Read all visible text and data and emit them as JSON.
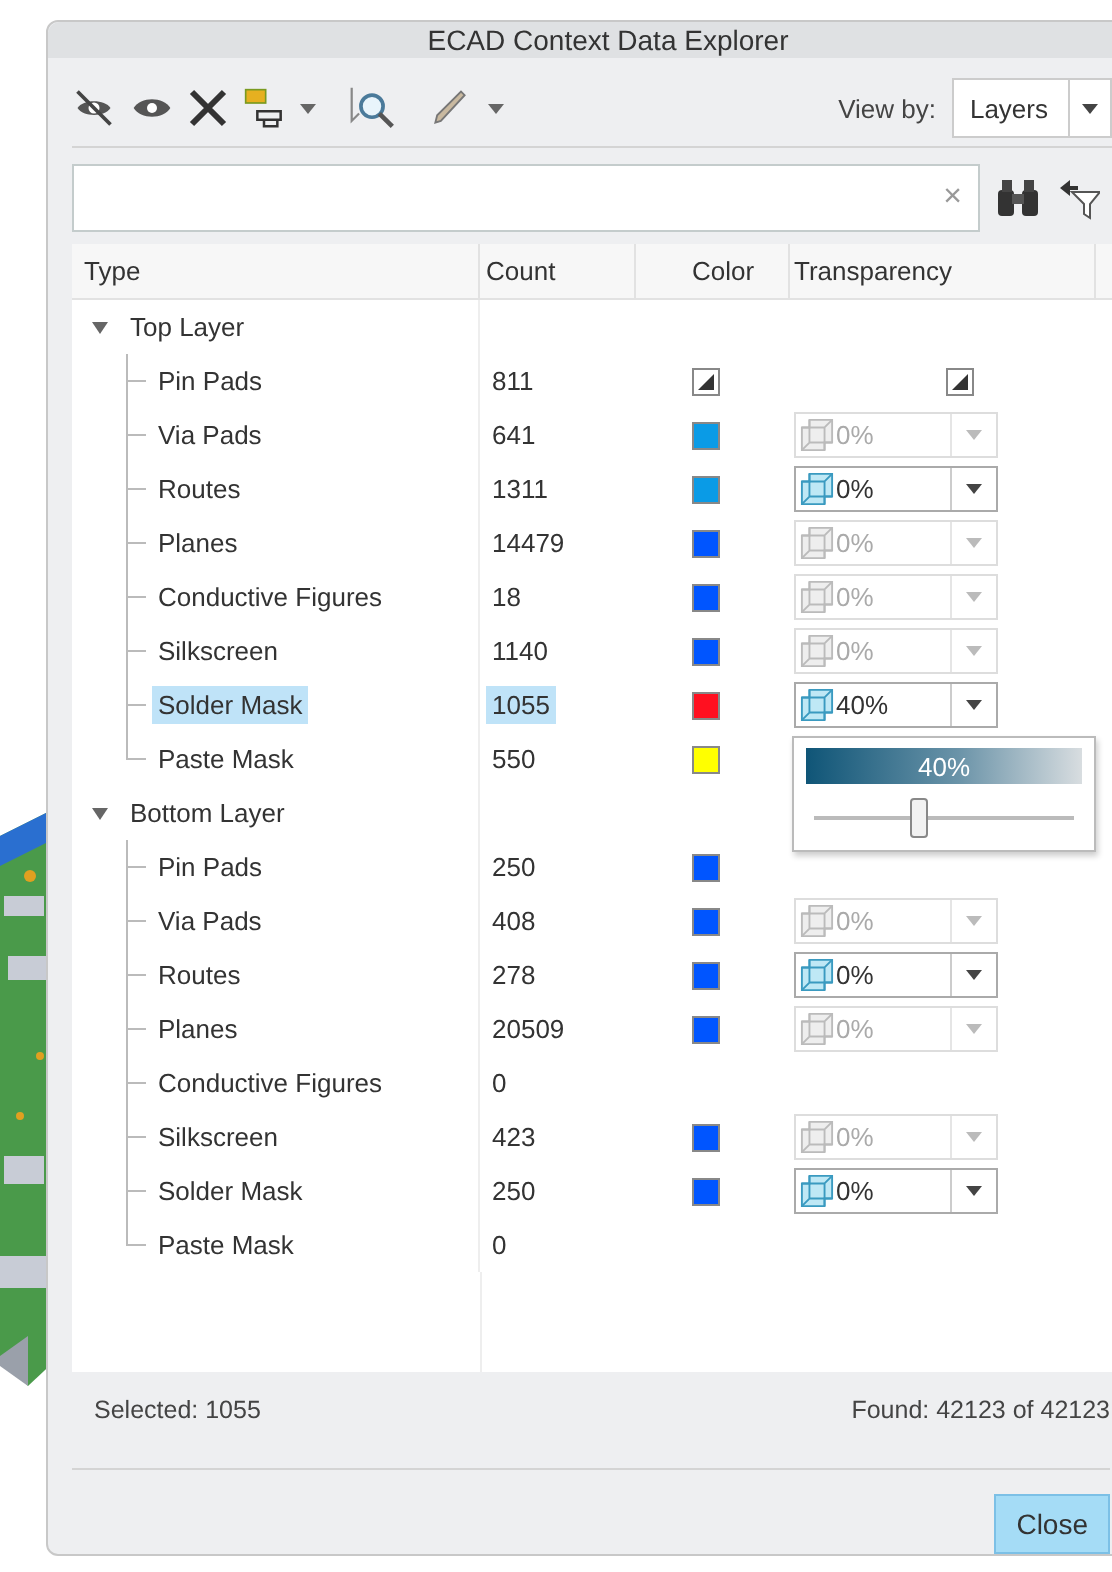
{
  "window": {
    "title": "ECAD Context Data Explorer"
  },
  "toolbar": {
    "view_by_label": "View by:",
    "view_by_value": "Layers"
  },
  "search": {
    "clear": "×"
  },
  "table": {
    "columns": [
      "Type",
      "Count",
      "Color",
      "Transparency"
    ],
    "groups": [
      {
        "name": "Top Layer",
        "expanded": true,
        "selected": false,
        "children": [
          {
            "name": "Pin Pads",
            "count": "811",
            "selected": false,
            "swatch": {
              "kind": "pattern"
            },
            "transparency": {
              "kind": "pattern"
            }
          },
          {
            "name": "Via Pads",
            "count": "641",
            "selected": false,
            "swatch": {
              "kind": "solid",
              "color": "#0a9be6"
            },
            "transparency": {
              "kind": "dropdown",
              "value": "0%",
              "disabled": true
            }
          },
          {
            "name": "Routes",
            "count": "1311",
            "selected": false,
            "swatch": {
              "kind": "solid",
              "color": "#0a9be6"
            },
            "transparency": {
              "kind": "dropdown",
              "value": "0%",
              "disabled": false
            }
          },
          {
            "name": "Planes",
            "count": "14479",
            "selected": false,
            "swatch": {
              "kind": "solid",
              "color": "#0055ff"
            },
            "transparency": {
              "kind": "dropdown",
              "value": "0%",
              "disabled": true
            }
          },
          {
            "name": "Conductive Figures",
            "count": "18",
            "selected": false,
            "swatch": {
              "kind": "solid",
              "color": "#0055ff"
            },
            "transparency": {
              "kind": "dropdown",
              "value": "0%",
              "disabled": true
            }
          },
          {
            "name": "Silkscreen",
            "count": "1140",
            "selected": false,
            "swatch": {
              "kind": "solid",
              "color": "#0055ff"
            },
            "transparency": {
              "kind": "dropdown",
              "value": "0%",
              "disabled": true
            }
          },
          {
            "name": "Solder Mask",
            "count": "1055",
            "selected": true,
            "swatch": {
              "kind": "solid",
              "color": "#ff1020"
            },
            "transparency": {
              "kind": "dropdown",
              "value": "40%",
              "disabled": false
            }
          },
          {
            "name": "Paste Mask",
            "count": "550",
            "selected": false,
            "swatch": {
              "kind": "solid",
              "color": "#ffff00"
            }
          }
        ]
      },
      {
        "name": "Bottom Layer",
        "expanded": true,
        "selected": false,
        "children": [
          {
            "name": "Pin Pads",
            "count": "250",
            "selected": false,
            "swatch": {
              "kind": "solid",
              "color": "#0055ff"
            }
          },
          {
            "name": "Via Pads",
            "count": "408",
            "selected": false,
            "swatch": {
              "kind": "solid",
              "color": "#0055ff"
            },
            "transparency": {
              "kind": "dropdown",
              "value": "0%",
              "disabled": true
            }
          },
          {
            "name": "Routes",
            "count": "278",
            "selected": false,
            "swatch": {
              "kind": "solid",
              "color": "#0055ff"
            },
            "transparency": {
              "kind": "dropdown",
              "value": "0%",
              "disabled": false
            }
          },
          {
            "name": "Planes",
            "count": "20509",
            "selected": false,
            "swatch": {
              "kind": "solid",
              "color": "#0055ff"
            },
            "transparency": {
              "kind": "dropdown",
              "value": "0%",
              "disabled": true
            }
          },
          {
            "name": "Conductive Figures",
            "count": "0",
            "selected": false
          },
          {
            "name": "Silkscreen",
            "count": "423",
            "selected": false,
            "swatch": {
              "kind": "solid",
              "color": "#0055ff"
            },
            "transparency": {
              "kind": "dropdown",
              "value": "0%",
              "disabled": true
            }
          },
          {
            "name": "Solder Mask",
            "count": "250",
            "selected": false,
            "swatch": {
              "kind": "solid",
              "color": "#0055ff"
            },
            "transparency": {
              "kind": "dropdown",
              "value": "0%",
              "disabled": false
            }
          },
          {
            "name": "Paste Mask",
            "count": "0",
            "selected": false
          }
        ]
      }
    ]
  },
  "transparency_popup": {
    "value": "40%",
    "level": 0.4
  },
  "status": {
    "selected": "Selected: 1055",
    "found": "Found: 42123 of 42123"
  },
  "buttons": [
    "Close"
  ]
}
